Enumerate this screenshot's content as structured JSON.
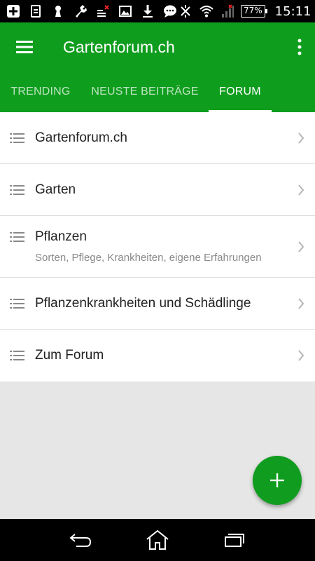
{
  "status_bar": {
    "battery": "77%",
    "time": "15:11",
    "icons": [
      "add-icon",
      "clipboard-icon",
      "keyhole-icon",
      "wrench-icon",
      "data-blocked-icon",
      "image-icon",
      "download-icon",
      "chat-icon",
      "no-signal-icon",
      "wifi-icon",
      "cell-signal-icon",
      "battery-icon"
    ]
  },
  "app_bar": {
    "title": "Gartenforum.ch",
    "color": "#0f9d1e"
  },
  "tabs": [
    {
      "label": "TRENDING",
      "active": false
    },
    {
      "label": "NEUSTE BEITRÄGE",
      "active": false
    },
    {
      "label": "FORUM",
      "active": true
    }
  ],
  "forum_items": [
    {
      "title": "Gartenforum.ch",
      "subtitle": ""
    },
    {
      "title": "Garten",
      "subtitle": ""
    },
    {
      "title": "Pflanzen",
      "subtitle": "Sorten, Pflege, Krankheiten, eigene Erfahrungen"
    },
    {
      "title": "Pflanzenkrankheiten und Schädlinge",
      "subtitle": ""
    },
    {
      "title": "Zum Forum",
      "subtitle": ""
    }
  ],
  "fab": {
    "icon": "plus-icon",
    "color": "#109c1f"
  },
  "nav_bar": {
    "icons": [
      "back-icon",
      "home-icon",
      "recent-apps-icon"
    ]
  }
}
